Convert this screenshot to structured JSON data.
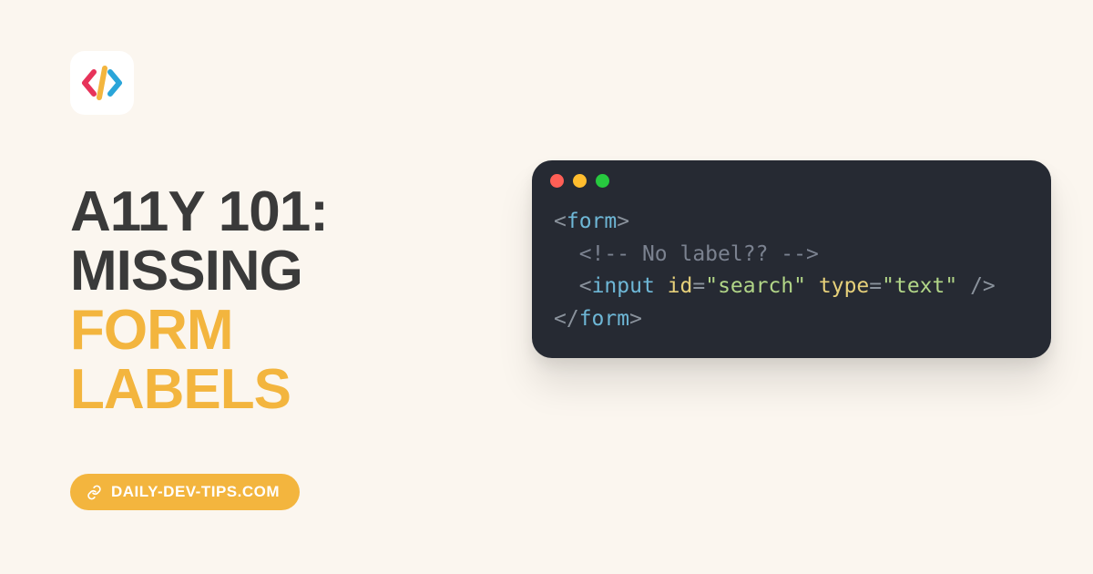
{
  "title": {
    "line1": "A11Y 101:",
    "line2": "Missing",
    "line3": "form",
    "line4": "labels"
  },
  "badge": {
    "label": "DAILY-DEV-TIPS.COM"
  },
  "code": {
    "line1": {
      "open": "<",
      "tag": "form",
      "close": ">"
    },
    "line2": {
      "indent": "  ",
      "comment": "<!-- No label?? -->"
    },
    "line3": {
      "indent": "  ",
      "open": "<",
      "tag": "input",
      "sp1": " ",
      "attr1": "id",
      "eq1": "=",
      "val1": "\"search\"",
      "sp2": " ",
      "attr2": "type",
      "eq2": "=",
      "val2": "\"text\"",
      "sp3": " ",
      "selfclose": "/>"
    },
    "line4": {
      "open": "</",
      "tag": "form",
      "close": ">"
    }
  }
}
